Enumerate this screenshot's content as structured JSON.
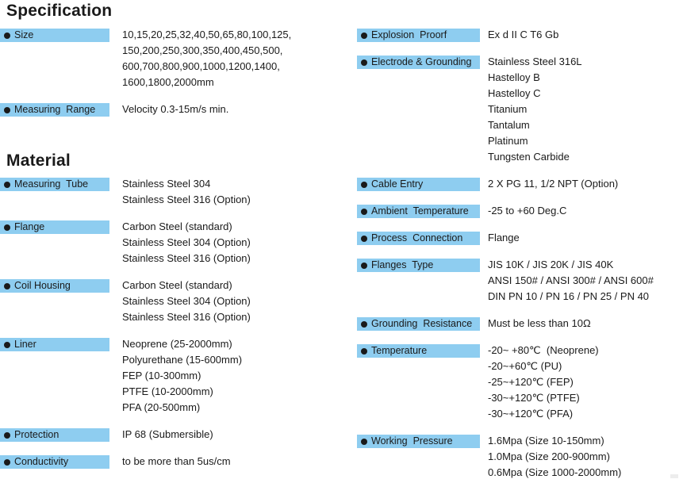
{
  "document": {
    "title": "Specification",
    "sections": [
      {
        "heading": "Specification",
        "column": "left",
        "rows": [
          {
            "label": "Size",
            "values": [
              "10,15,20,25,32,40,50,65,80,100,125,",
              "150,200,250,300,350,400,450,500,",
              "600,700,800,900,1000,1200,1400,",
              "1600,1800,2000mm"
            ]
          },
          {
            "label": "Measuring  Range",
            "values": [
              "Velocity 0.3-15m/s min."
            ]
          }
        ]
      },
      {
        "heading": "Material",
        "column": "left",
        "rows": [
          {
            "label": "Measuring  Tube",
            "values": [
              "Stainless Steel 304",
              "Stainless Steel 316 (Option)"
            ]
          },
          {
            "label": "Flange",
            "values": [
              "Carbon Steel (standard)",
              "Stainless Steel 304 (Option)",
              "Stainless Steel 316 (Option)"
            ]
          },
          {
            "label": "Coil Housing",
            "values": [
              "Carbon Steel (standard)",
              "Stainless Steel 304 (Option)",
              "Stainless Steel 316 (Option)"
            ]
          },
          {
            "label": "Liner",
            "values": [
              "Neoprene (25-2000mm)",
              "Polyurethane (15-600mm)",
              "FEP (10-300mm)",
              "PTFE (10-2000mm)",
              "PFA (20-500mm)"
            ]
          },
          {
            "label": "Protection",
            "values": [
              "IP 68 (Submersible)"
            ]
          },
          {
            "label": "Conductivity",
            "values": [
              "to be more than 5us/cm"
            ]
          }
        ]
      }
    ],
    "right_column_rows": [
      {
        "label": "Explosion  Proorf",
        "values": [
          "Ex d II C T6 Gb"
        ]
      },
      {
        "label": "Electrode & Grounding",
        "values": [
          "Stainless Steel 316L",
          "Hastelloy B",
          "Hastelloy C",
          "Titanium",
          "Tantalum",
          "Platinum",
          "Tungsten Carbide"
        ]
      },
      {
        "label": "Cable Entry",
        "values": [
          "2 X PG 11, 1/2 NPT (Option)"
        ]
      },
      {
        "label": "Ambient  Temperature",
        "values": [
          "-25 to +60 Deg.C"
        ]
      },
      {
        "label": "Process  Connection",
        "values": [
          "Flange"
        ]
      },
      {
        "label": "Flanges  Type",
        "values": [
          "JIS 10K / JIS 20K / JIS 40K",
          "ANSI 150# / ANSI 300# / ANSI 600#",
          "DIN PN 10 / PN 16 / PN 25 / PN 40"
        ]
      },
      {
        "label": "Grounding  Resistance",
        "values": [
          "Must be less than 10Ω"
        ]
      },
      {
        "label": "Temperature",
        "values": [
          "-20~ +80℃  (Neoprene)",
          "-20~+60℃ (PU)",
          "-25~+120℃ (FEP)",
          "-30~+120℃ (PTFE)",
          "-30~+120℃ (PFA)"
        ]
      },
      {
        "label": "Working  Pressure",
        "values": [
          "1.6Mpa (Size 10-150mm)",
          "1.0Mpa (Size 200-900mm)",
          "0.6Mpa (Size 1000-2000mm)"
        ]
      }
    ],
    "colors": {
      "label_bar": "#8ecdf0",
      "text": "#1a1a1a",
      "background": "#ffffff"
    }
  }
}
